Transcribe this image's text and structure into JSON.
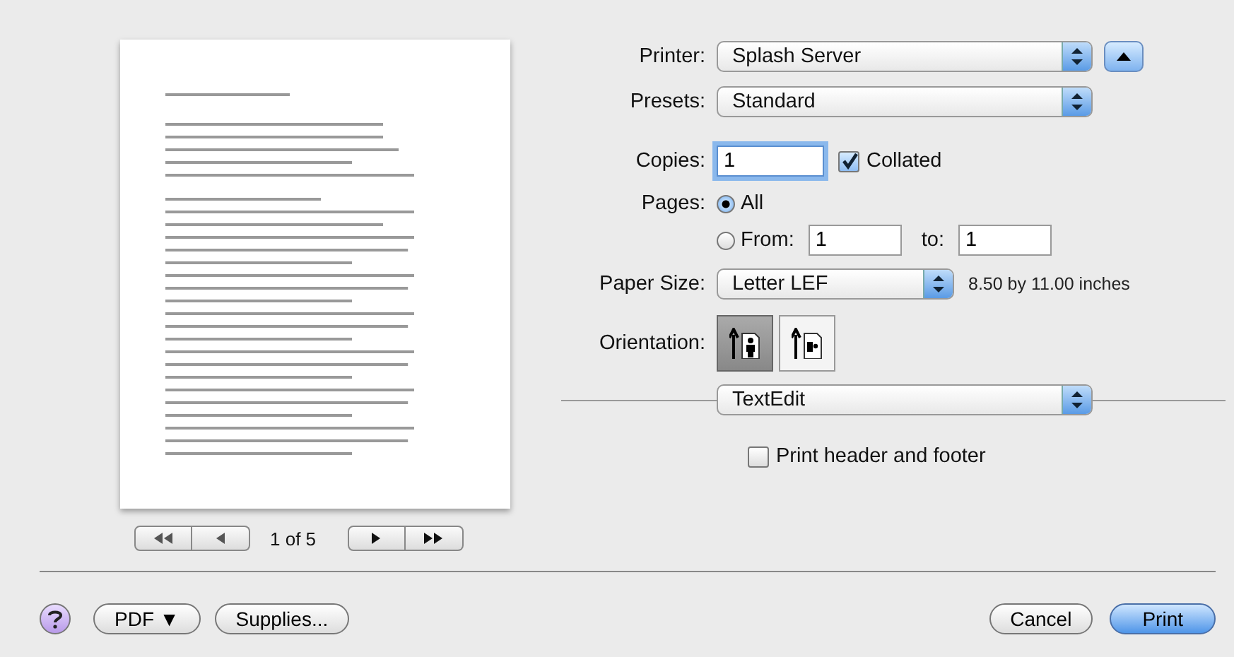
{
  "preview": {
    "page_indicator": "1 of 5"
  },
  "printer": {
    "label": "Printer:",
    "value": "Splash Server"
  },
  "presets": {
    "label": "Presets:",
    "value": "Standard"
  },
  "copies": {
    "label": "Copies:",
    "value": "1",
    "collated": {
      "label": "Collated",
      "checked": true
    }
  },
  "pages": {
    "label": "Pages:",
    "options": [
      {
        "label": "All",
        "selected": true
      },
      {
        "label": "From:",
        "selected": false
      }
    ],
    "from": "1",
    "to_label": "to:",
    "to": "1"
  },
  "paper_size": {
    "label": "Paper Size:",
    "value": "Letter LEF",
    "dimensions": "8.50 by 11.00 inches"
  },
  "orientation": {
    "label": "Orientation:",
    "options": [
      {
        "kind": "portrait",
        "selected": true
      },
      {
        "kind": "landscape",
        "selected": false
      }
    ]
  },
  "app_menu": {
    "value": "TextEdit"
  },
  "header_footer": {
    "label": "Print header and footer",
    "checked": false
  },
  "buttons": {
    "pdf": "PDF ▼",
    "supplies": "Supplies...",
    "cancel": "Cancel",
    "print": "Print"
  }
}
